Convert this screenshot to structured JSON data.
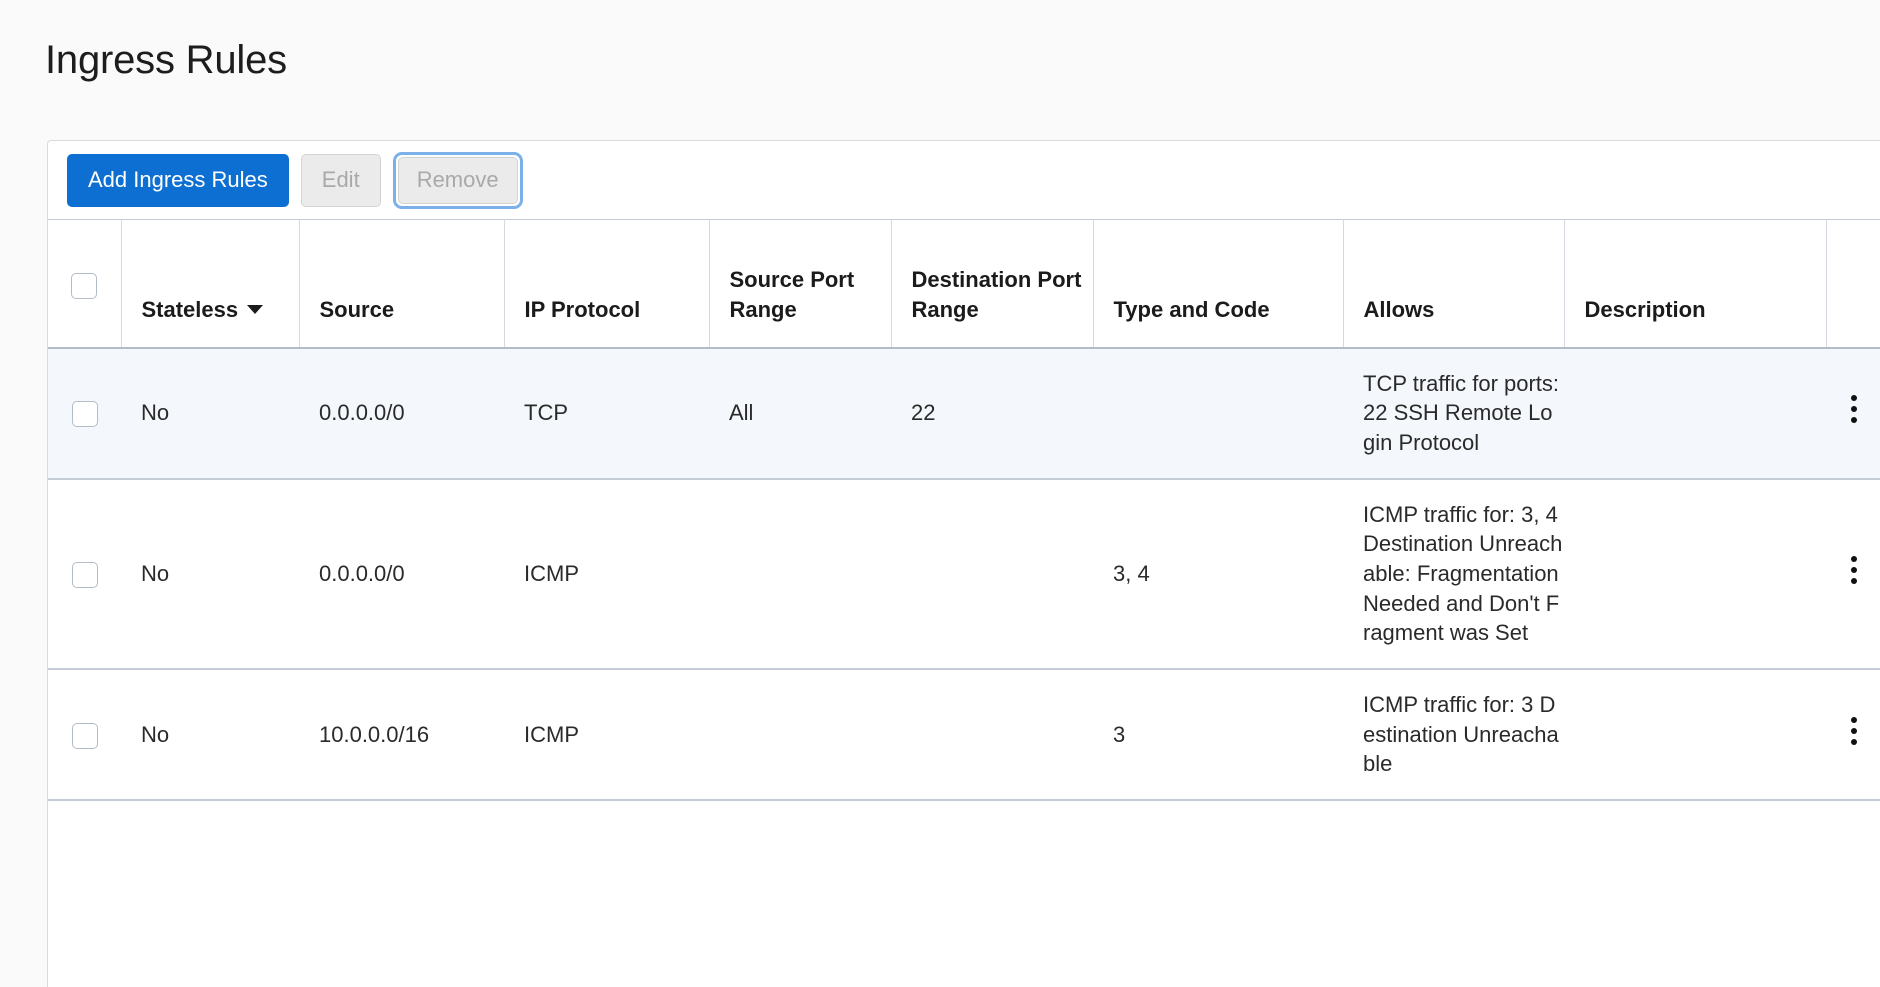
{
  "page": {
    "title": "Ingress Rules"
  },
  "toolbar": {
    "add_label": "Add Ingress Rules",
    "edit_label": "Edit",
    "remove_label": "Remove"
  },
  "table": {
    "select_all_checkbox": "",
    "columns": [
      {
        "key": "checkbox",
        "label": ""
      },
      {
        "key": "stateless",
        "label": "Stateless",
        "sortable": true,
        "sort_icon": "caret-down-icon"
      },
      {
        "key": "source",
        "label": "Source"
      },
      {
        "key": "ip_protocol",
        "label": "IP Protocol"
      },
      {
        "key": "source_port",
        "label": "Source Port Range"
      },
      {
        "key": "dest_port",
        "label": "Destination Port Range"
      },
      {
        "key": "type_code",
        "label": "Type and Code"
      },
      {
        "key": "allows",
        "label": "Allows"
      },
      {
        "key": "description",
        "label": "Description"
      },
      {
        "key": "actions",
        "label": ""
      }
    ],
    "rows": [
      {
        "selected": true,
        "stateless": "No",
        "source": "0.0.0.0/0",
        "ip_protocol": "TCP",
        "source_port": "All",
        "dest_port": "22",
        "type_code": "",
        "allows": "TCP traffic for ports: 22 SSH Remote Login Protocol",
        "description": "",
        "actions_icon": "kebab-menu-icon"
      },
      {
        "selected": false,
        "stateless": "No",
        "source": "0.0.0.0/0",
        "ip_protocol": "ICMP",
        "source_port": "",
        "dest_port": "",
        "type_code": "3, 4",
        "allows": "ICMP traffic for: 3, 4 Destination Unreachable: Fragmentation Needed and Don't Fragment was Set",
        "description": "",
        "actions_icon": "kebab-menu-icon"
      },
      {
        "selected": false,
        "stateless": "No",
        "source": "10.0.0.0/16",
        "ip_protocol": "ICMP",
        "source_port": "",
        "dest_port": "",
        "type_code": "3",
        "allows": "ICMP traffic for: 3 Destination Unreachable",
        "description": "",
        "actions_icon": "kebab-menu-icon"
      }
    ]
  },
  "colors": {
    "primary": "#0c6fd1",
    "focus_ring": "#7cb0e8",
    "selected_row": "#f4f7fb",
    "disabled_text": "#a9a9a9",
    "border": "#c5cbd4",
    "page_bg": "#fafafa"
  }
}
